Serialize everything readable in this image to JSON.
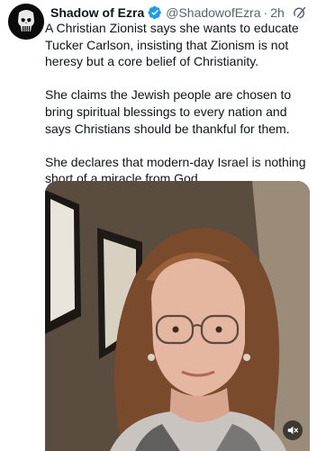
{
  "tweet": {
    "author_name": "Shadow of Ezra",
    "handle": "@ShadowofEzra",
    "separator": "·",
    "time": "2h",
    "paragraphs": [
      "A Christian Zionist says she wants to educate Tucker Carlson, insisting that Zionism is not heresy but a core belief of Christianity.",
      "She claims the Jewish people are chosen to bring spiritual blessings to every nation and says Christians should be thankful for them.",
      "She declares that modern-day Israel is nothing short of a miracle from God."
    ]
  },
  "icons": {
    "avatar": "punisher-skull-avatar",
    "verified": "verified-badge-icon",
    "grok": "grok-icon",
    "mute": "speaker-muted-icon"
  },
  "colors": {
    "verified_blue": "#1d9bf0",
    "secondary_text": "#536471",
    "primary_text": "#0f1419"
  }
}
